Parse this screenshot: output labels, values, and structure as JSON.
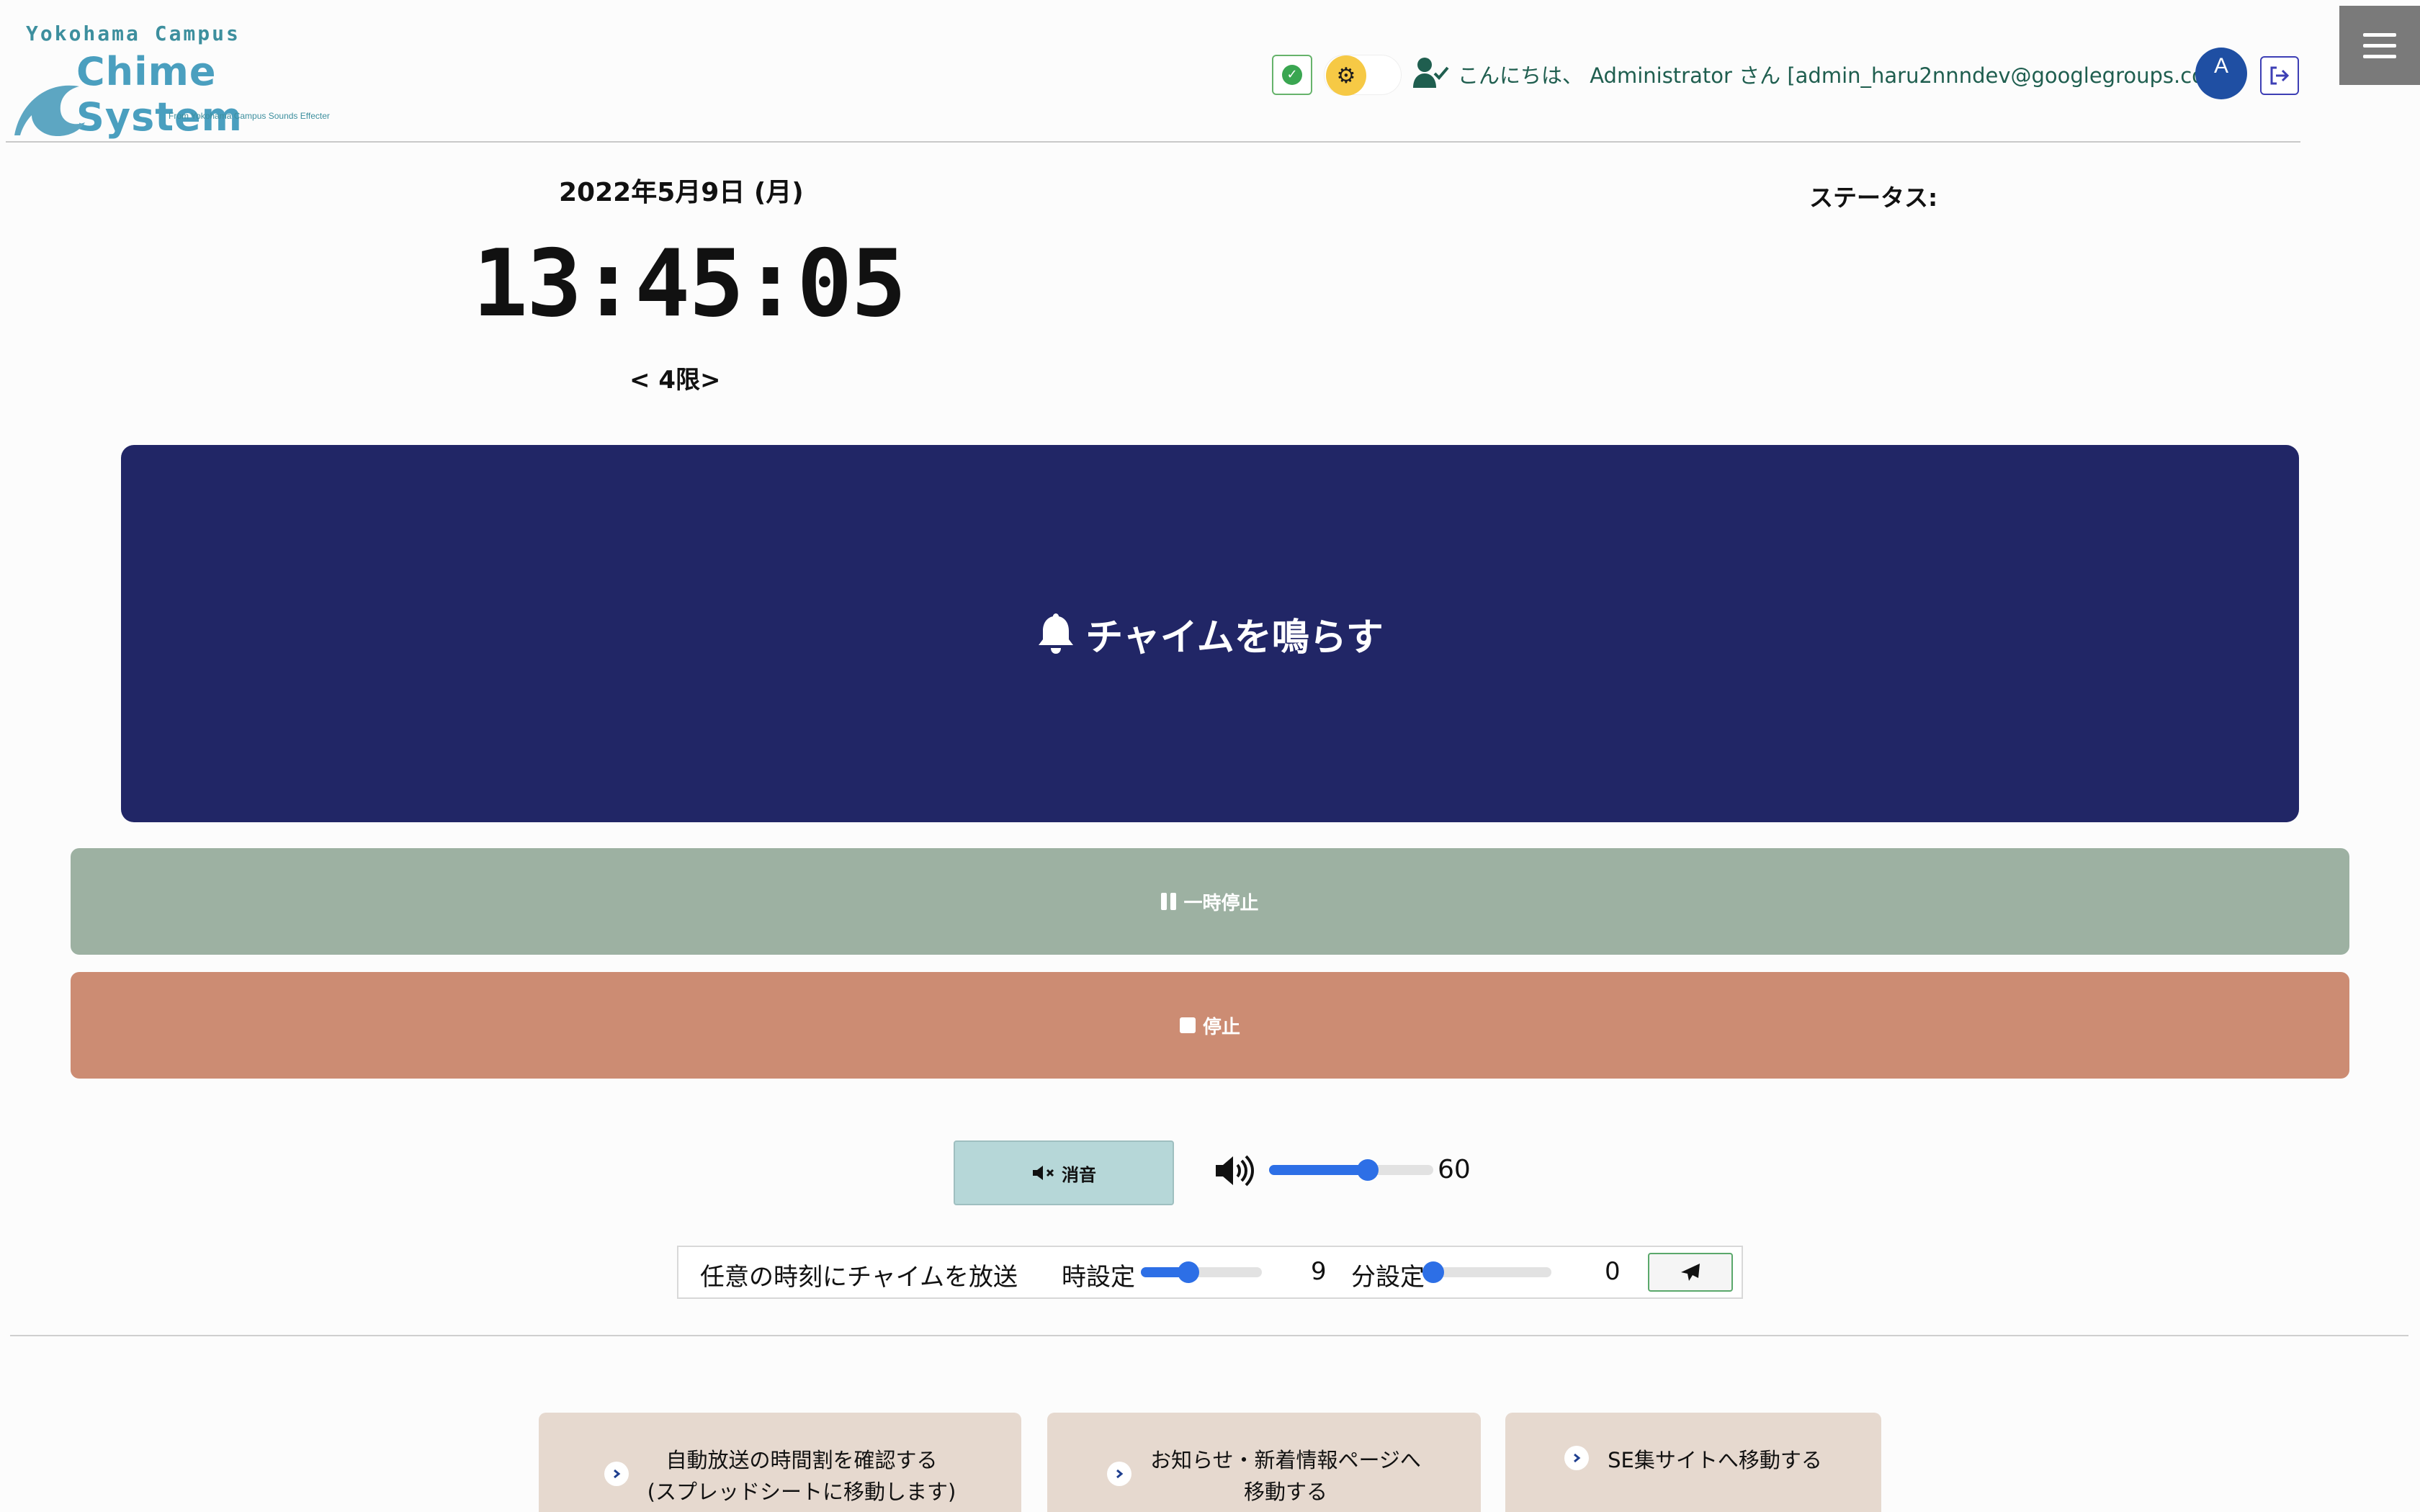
{
  "header": {
    "logo_campus": "Yokohama Campus",
    "logo_title": "Chime System",
    "logo_subtitle": "From Yokohama Campus Sounds Effecter",
    "greeting": "こんにちは、 Administrator さん [admin_haru2nnndev@googlegroups.com]",
    "avatar_letter": "A"
  },
  "clock": {
    "date": "2022年5月9日 (月)",
    "time": "13:45:05",
    "period": "< 4限>"
  },
  "status": {
    "label": "ステータス:"
  },
  "controls": {
    "chime_label": "チャイムを鳴らす",
    "pause_label": "一時停止",
    "stop_label": "停止",
    "mute_label": "消音",
    "volume_value": "60",
    "volume_level": 60
  },
  "schedule": {
    "label": "任意の時刻にチャイムを放送",
    "hour_label": "時設定",
    "hour_value": "9",
    "hour_level": 9,
    "hour_max": 23,
    "minute_label": "分設定",
    "minute_value": "0",
    "minute_level": 0,
    "minute_max": 59
  },
  "links": [
    {
      "label": "自動放送の時間割を確認する\n(スプレッドシートに移動します)"
    },
    {
      "label": "お知らせ・新着情報ページへ\n移動する"
    },
    {
      "label": "SE集サイトへ移動する"
    }
  ],
  "colors": {
    "chime_button": "#212666",
    "pause_button": "#9db1a2",
    "stop_button": "#cc8c73",
    "mute_button": "#b6d7d8",
    "link_card": "#e6d9cf",
    "slider": "#2d6fe6",
    "avatar": "#1f4fa3"
  }
}
